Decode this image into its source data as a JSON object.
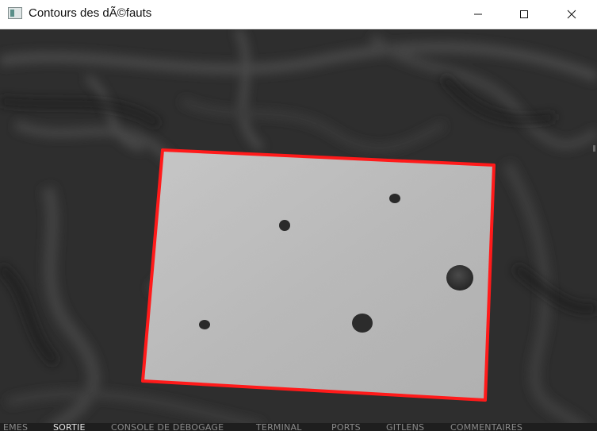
{
  "window": {
    "title": "Contours des dÃ©fauts",
    "icon": "opencv-window-icon",
    "controls": [
      "minimize-icon",
      "maximize-icon",
      "close-icon"
    ]
  },
  "image": {
    "description_colors": {
      "cloth": "#2f2f2f",
      "paper": "#b9b9b9",
      "contour": "#ff1a1a",
      "defect": "#2a2a2a"
    },
    "contour_count": 1,
    "defect_count": 5
  },
  "bottom_panel": {
    "tabs": [
      {
        "label": "EMES",
        "active": false
      },
      {
        "label": "SORTIE",
        "active": true
      },
      {
        "label": "CONSOLE DE DÉBOGAGE",
        "active": false
      },
      {
        "label": "TERMINAL",
        "active": false
      },
      {
        "label": "PORTS",
        "active": false
      },
      {
        "label": "GITLENS",
        "active": false
      },
      {
        "label": "COMMENTAIRES",
        "active": false
      }
    ]
  }
}
